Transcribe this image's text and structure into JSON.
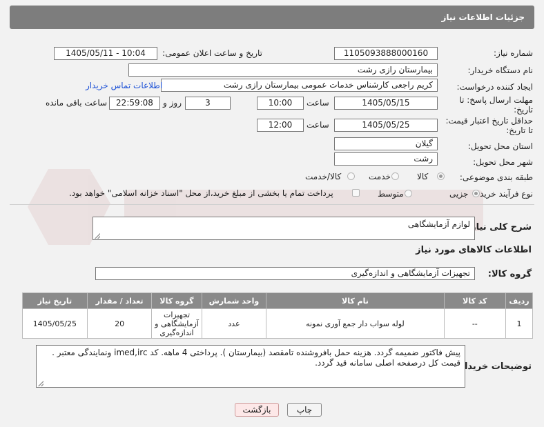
{
  "header": {
    "title": "جزئیات اطلاعات نیاز"
  },
  "fields": {
    "need_number_label": "شماره نیاز:",
    "need_number": "1105093888000160",
    "announce_label": "تاریخ و ساعت اعلان عمومی:",
    "announce_value": "1405/05/11 - 10:04",
    "buyer_org_label": "نام دستگاه خریدار:",
    "buyer_org": "بیمارستان رازی رشت",
    "requester_label": "ایجاد کننده درخواست:",
    "requester": "کریم راجعی کارشناس خدمات عمومی بیمارستان رازی رشت",
    "contact_link": "اطلاعات تماس خریدار",
    "deadline_label_1": "مهلت ارسال پاسخ: تا",
    "deadline_label_2": "تاریخ:",
    "deadline_date": "1405/05/15",
    "time_label": "ساعت",
    "deadline_time": "10:00",
    "days_value": "3",
    "days_label": "روز و",
    "remaining_value": "22:59:08",
    "remaining_label": "ساعت باقی مانده",
    "validity_label_1": "حداقل تاریخ اعتبار قیمت:",
    "validity_label_2": "تا تاریخ:",
    "validity_date": "1405/05/25",
    "validity_time_label": "ساعت",
    "validity_time": "12:00",
    "province_label": "استان محل تحویل:",
    "province": "گیلان",
    "city_label": "شهر محل تحویل:",
    "city": "رشت",
    "category_label": "طبقه بندی موضوعی:",
    "category_options": [
      "کالا",
      "خدمت",
      "کالا/خدمت"
    ],
    "process_label": "نوع فرآیند خرید :",
    "process_options": [
      "جزیی",
      "متوسط"
    ],
    "payment_text": "پرداخت تمام یا بخشی از مبلغ خرید،از محل \"اسناد خزانه اسلامی\" خواهد بود."
  },
  "description": {
    "label": "شرح کلی نیاز:",
    "value": "لوازم آزمایشگاهی"
  },
  "goods": {
    "section_title": "اطلاعات کالاهای مورد نیاز",
    "group_label": "گروه کالا:",
    "group_value": "تجهیزات آزمایشگاهی و اندازه‌گیری",
    "columns": [
      "ردیف",
      "کد کالا",
      "نام کالا",
      "واحد شمارش",
      "گروه کالا",
      "تعداد / مقدار",
      "تاریخ نیاز"
    ],
    "rows": [
      [
        "1",
        "--",
        "لوله سواب دار جمع آوری نمونه",
        "عدد",
        "تجهیزات آزمایشگاهی و اندازه‌گیری",
        "20",
        "1405/05/25"
      ]
    ]
  },
  "buyer_notes": {
    "label": "توضیحات خریدار:",
    "line1": "پیش فاکتور ضمیمه گردد. هزینه حمل بافروشنده تامقصد (بیمارستان ). پرداختی 4 ماهه. کد imed,irc ونمایندگی معتبر .",
    "line2": "قیمت کل درصفحه اصلی سامانه قید گردد."
  },
  "buttons": {
    "print": "چاپ",
    "back": "بازگشت"
  },
  "colors": {
    "header_bg": "#7d7d7d",
    "link": "#1a4fd6",
    "back_btn_bg": "#fde8e8"
  }
}
